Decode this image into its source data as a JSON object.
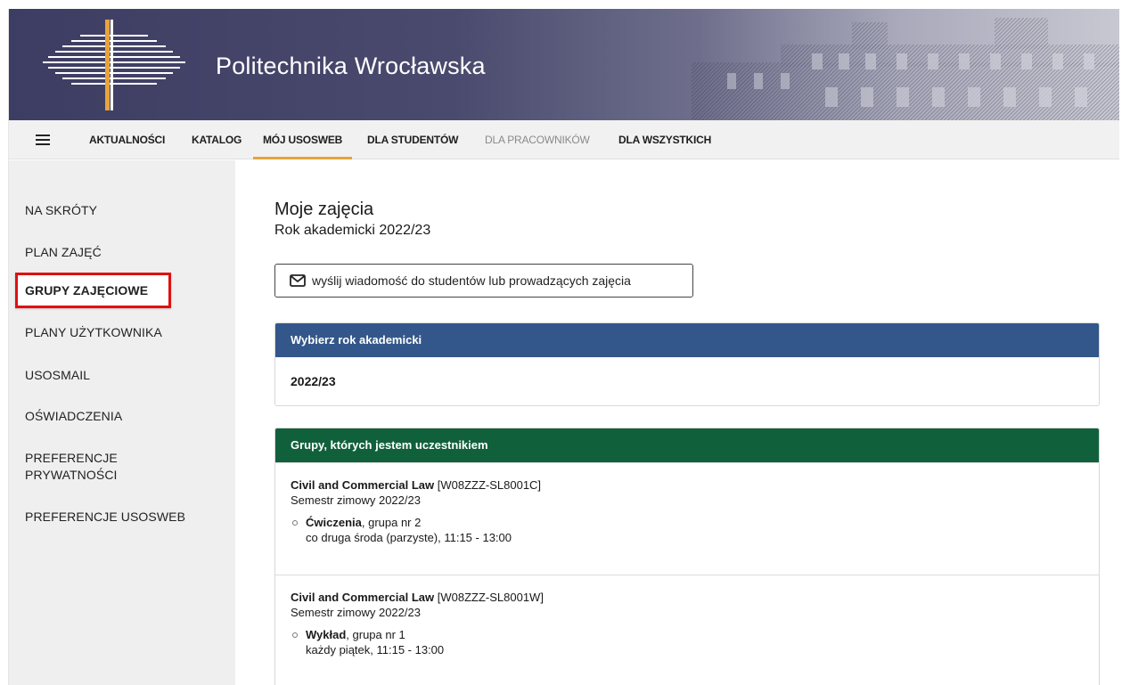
{
  "header": {
    "title": "Politechnika Wrocławska",
    "logo_icon": "pwr-logo-icon"
  },
  "nav": {
    "menu_icon": "hamburger-menu-icon",
    "items": [
      {
        "label": "AKTUALNOŚCI",
        "state": "normal"
      },
      {
        "label": "KATALOG",
        "state": "normal"
      },
      {
        "label": "MÓJ USOSWEB",
        "state": "active"
      },
      {
        "label": "DLA STUDENTÓW",
        "state": "normal"
      },
      {
        "label": "DLA PRACOWNIKÓW",
        "state": "muted"
      },
      {
        "label": "DLA WSZYSTKICH",
        "state": "normal"
      }
    ],
    "active_underline_color": "#e6a43a"
  },
  "sidebar": {
    "items": [
      {
        "label": "NA SKRÓTY"
      },
      {
        "label": "PLAN ZAJĘĆ"
      },
      {
        "label": "GRUPY ZAJĘCIOWE"
      },
      {
        "label": "PLANY UŻYTKOWNIKA"
      },
      {
        "label": "USOSMAIL"
      },
      {
        "label": "OŚWIADCZENIA"
      },
      {
        "label": "PREFERENCJE PRYWATNOŚCI",
        "line1": "PREFERENCJE",
        "line2": "PRYWATNOŚCI"
      },
      {
        "label": "PREFERENCJE USOSWEB"
      }
    ],
    "active_index": 2,
    "highlight_color": "#e01010"
  },
  "main": {
    "title": "Moje zajęcia",
    "subtitle": "Rok akademicki 2022/23",
    "message_button": {
      "label": "wyślij wiadomość do studentów lub prowadzących zajęcia",
      "icon": "envelope-icon"
    },
    "year_panel": {
      "heading": "Wybierz rok akademicki",
      "heading_color": "#33578a",
      "value": "2022/23"
    },
    "groups_panel": {
      "heading": "Grupy, których jestem uczestnikiem",
      "heading_color": "#11603c",
      "courses": [
        {
          "name": "Civil and Commercial Law",
          "code": "[W08ZZZ-SL8001C]",
          "semester": "Semestr zimowy 2022/23",
          "group_type": "Ćwiczenia",
          "group_no": ", grupa nr 2",
          "schedule": "co druga środa (parzyste), 11:15 - 13:00"
        },
        {
          "name": "Civil and Commercial Law",
          "code": "[W08ZZZ-SL8001W]",
          "semester": "Semestr zimowy 2022/23",
          "group_type": "Wykład",
          "group_no": ", grupa nr 1",
          "schedule": "każdy piątek, 11:15 - 13:00"
        }
      ]
    }
  }
}
